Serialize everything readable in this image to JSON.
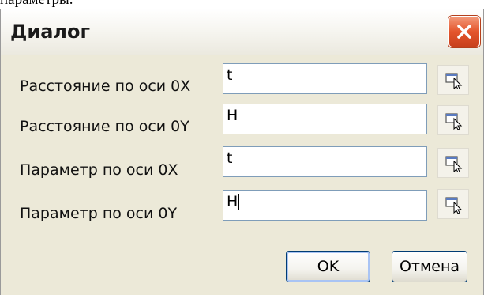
{
  "background_text": "параметры.",
  "dialog": {
    "title": "Диалог"
  },
  "rows": [
    {
      "label": "Расстояние по оси 0X",
      "value": "t"
    },
    {
      "label": "Расстояние по оси 0Y",
      "value": "H"
    },
    {
      "label": "Параметр по оси 0X",
      "value": "t"
    },
    {
      "label": "Параметр по оси 0Y",
      "value": "H"
    }
  ],
  "buttons": {
    "ok": "OK",
    "cancel": "Отмена"
  },
  "icons": {
    "close": "close-icon",
    "pick": "pick-cursor-icon"
  },
  "colors": {
    "dialog_bg": "#ece9d8",
    "close_red": "#e4552c",
    "input_border": "#7f9db9"
  }
}
